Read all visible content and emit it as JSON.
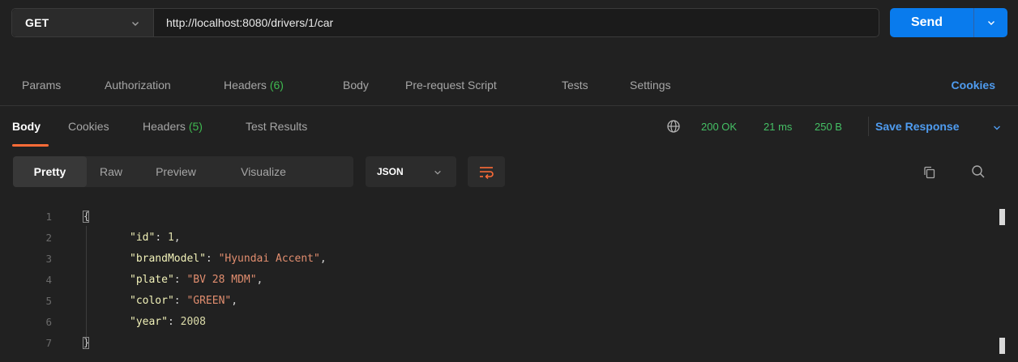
{
  "request": {
    "method": "GET",
    "url": "http://localhost:8080/drivers/1/car",
    "send_label": "Send"
  },
  "request_tabs": [
    {
      "label": "Params"
    },
    {
      "label": "Authorization"
    },
    {
      "label": "Headers",
      "count": "(6)"
    },
    {
      "label": "Body"
    },
    {
      "label": "Pre-request Script"
    },
    {
      "label": "Tests"
    },
    {
      "label": "Settings"
    }
  ],
  "cookies_link": "Cookies",
  "response": {
    "tabs": [
      {
        "label": "Body",
        "active": true
      },
      {
        "label": "Cookies"
      },
      {
        "label": "Headers",
        "count": "(5)"
      },
      {
        "label": "Test Results"
      }
    ],
    "status": "200 OK",
    "time": "21 ms",
    "size": "250 B",
    "save_label": "Save Response"
  },
  "view": {
    "modes": [
      "Pretty",
      "Raw",
      "Preview",
      "Visualize"
    ],
    "active_mode": "Pretty",
    "format": "JSON"
  },
  "body": {
    "line_numbers": [
      "1",
      "2",
      "3",
      "4",
      "5",
      "6",
      "7"
    ],
    "open_brace": "{",
    "close_brace": "}",
    "fields": [
      {
        "key": "\"id\"",
        "value": "1",
        "type": "number"
      },
      {
        "key": "\"brandModel\"",
        "value": "\"Hyundai Accent\"",
        "type": "string"
      },
      {
        "key": "\"plate\"",
        "value": "\"BV 28 MDM\"",
        "type": "string"
      },
      {
        "key": "\"color\"",
        "value": "\"GREEN\"",
        "type": "string"
      },
      {
        "key": "\"year\"",
        "value": "2008",
        "type": "number"
      }
    ]
  },
  "colors": {
    "accent": "#097bed",
    "link": "#4f9cf0",
    "status_ok": "#45c065",
    "active_tab_underline": "#ff6c37"
  },
  "icons": [
    "chevron-down-icon",
    "globe-icon",
    "wrap-lines-icon",
    "copy-icon",
    "search-icon"
  ]
}
